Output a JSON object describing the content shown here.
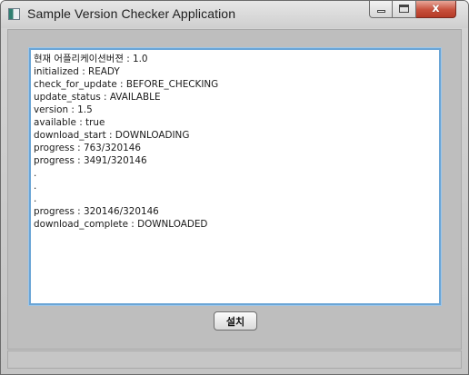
{
  "window": {
    "title": "Sample Version Checker Application",
    "icon": "app-window-icon",
    "controls": {
      "minimize": "minimize-icon",
      "maximize": "maximize-icon",
      "close_glyph": "x"
    }
  },
  "log": {
    "lines": [
      "현재 어플리케이션버젼 : 1.0",
      "initialized : READY",
      "check_for_update : BEFORE_CHECKING",
      "update_status : AVAILABLE",
      "version : 1.5",
      "available : true",
      "download_start : DOWNLOADING",
      "progress : 763/320146",
      "progress : 3491/320146",
      ".",
      ".",
      ".",
      "progress : 320146/320146",
      "download_complete : DOWNLOADED"
    ]
  },
  "actions": {
    "install_label": "설치"
  }
}
